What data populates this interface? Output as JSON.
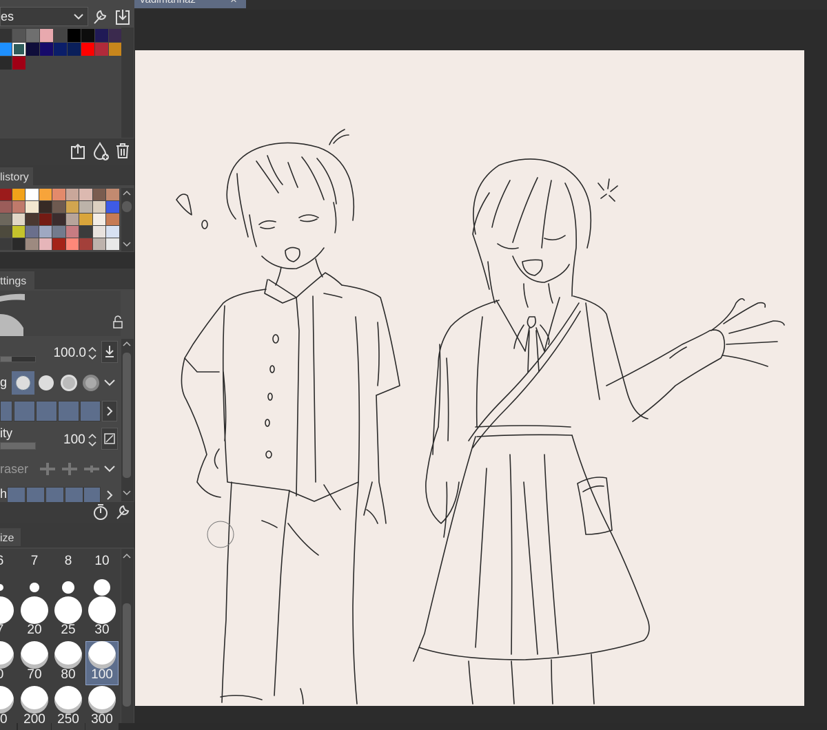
{
  "top_panel": {
    "dropdown_text": "es"
  },
  "color_set": {
    "rows": [
      [
        "#333333",
        "#555555",
        "#6f6f6f",
        "#e8a9ae",
        "#444444",
        "#000000",
        "#0d0d0d",
        "#201a56",
        "#3b2a4e"
      ],
      [
        "#1e90ff",
        "#2e5c5a",
        "#0f0d3a",
        "#160a6a",
        "#0b1e69",
        "#0a1f5a",
        "#ff0000",
        "#b02a3a",
        "#c8861c"
      ],
      [
        "#2a2a2a",
        "#a00015"
      ]
    ]
  },
  "history_panel": {
    "tab_label": "listory",
    "rows": [
      [
        "#9b1b1b",
        "#f2a21a",
        "#ffffff",
        "#f7a43a",
        "#e38a6b",
        "#c9a79a",
        "#dcb9b0",
        "#7a5c4f",
        "#c28a70"
      ],
      [
        "#9b5d5a",
        "#c07a6b",
        "#f3e7cf",
        "#372a25",
        "#6e5a50",
        "#d1a54f",
        "#bcb3a9",
        "#dcd0c0",
        "#3e5be6"
      ],
      [
        "#6c675c",
        "#e1d7c7",
        "#4a3831",
        "#741b14",
        "#3b2c2d",
        "#b7a49b",
        "#d9a53b",
        "#f3ede6",
        "#c67b55"
      ],
      [
        "#4d4a3d",
        "#c5c32c",
        "#6a6f8c",
        "#9fa8c2",
        "#737b8d",
        "#c77c82",
        "#3c3c3c",
        "#e8e2de",
        "#d7e1f2"
      ],
      [
        "#3b3b3b",
        "#2a2a2a",
        "#9d8a80",
        "#e6b5b9",
        "#a42318",
        "#ff8879",
        "#a3403a",
        "#bdb2ac",
        "#e8e8e8"
      ]
    ]
  },
  "settings_panel": {
    "tab_label": "ttings",
    "size_value": "100.0",
    "hardness_label": "g",
    "opacity_label": "ity",
    "opacity_value": "100",
    "eraser_label": "raser",
    "last_label": "h"
  },
  "brush_size_panel": {
    "tab_label": "ize",
    "rows": [
      [
        "6",
        "7",
        "8",
        "10"
      ],
      [
        "7",
        "20",
        "25",
        "30"
      ],
      [
        "0",
        "70",
        "80",
        "100"
      ],
      [
        "70",
        "200",
        "250",
        "300"
      ]
    ],
    "selected": "100"
  },
  "document_tab": {
    "title": "vadimanhaz",
    "close_glyph": "×"
  },
  "canvas": {
    "background": "#f3ebe6"
  }
}
